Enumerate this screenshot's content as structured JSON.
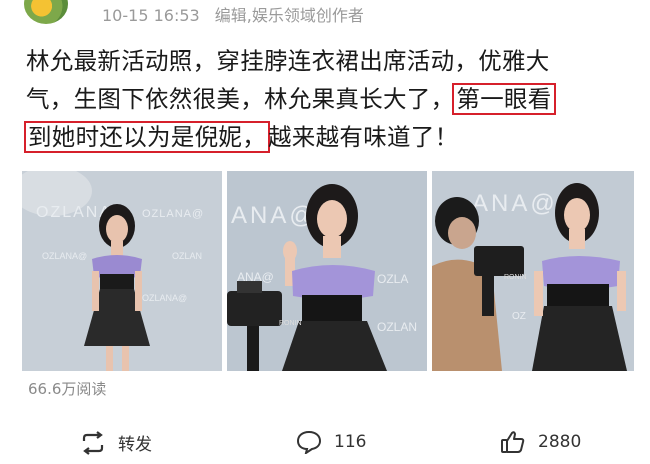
{
  "header": {
    "timestamp": "10-15 16:53",
    "meta": "编辑,娱乐领域创作者"
  },
  "post": {
    "line1": "林允最新活动照，穿挂脖连衣裙出席活动，优雅大",
    "line2_a": "气，生图下依然很美，林允果真长大了，",
    "line2_hl": "第一眼看",
    "line3_hl": "到她时还以为是倪妮，",
    "line3_b": "越来越有味道了！"
  },
  "photos": [
    {
      "backdrop_text": "OZLANA@"
    },
    {
      "backdrop_text": "ANA@"
    },
    {
      "backdrop_text": "ANA@"
    }
  ],
  "stats": {
    "reads": "66.6万阅读"
  },
  "actions": {
    "share_label": "转发",
    "comment_count": "116",
    "like_count": "2880"
  },
  "colors": {
    "highlight_border": "#d6202b",
    "meta_text": "#9a9a9a"
  }
}
